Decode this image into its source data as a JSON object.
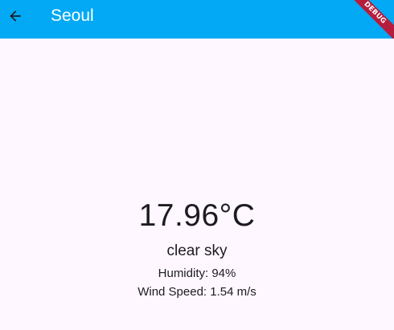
{
  "app_bar": {
    "title": "Seoul",
    "back_icon": "arrow-back-icon",
    "color": "#03A9F4"
  },
  "debug_banner": {
    "label": "DEBUG",
    "color": "#B71C3C"
  },
  "weather": {
    "temperature": "17.96°C",
    "description": "clear sky",
    "humidity": "Humidity: 94%",
    "wind_speed": "Wind Speed: 1.54 m/s"
  },
  "colors": {
    "background": "#FEF7FF",
    "text": "#1D1B20"
  }
}
